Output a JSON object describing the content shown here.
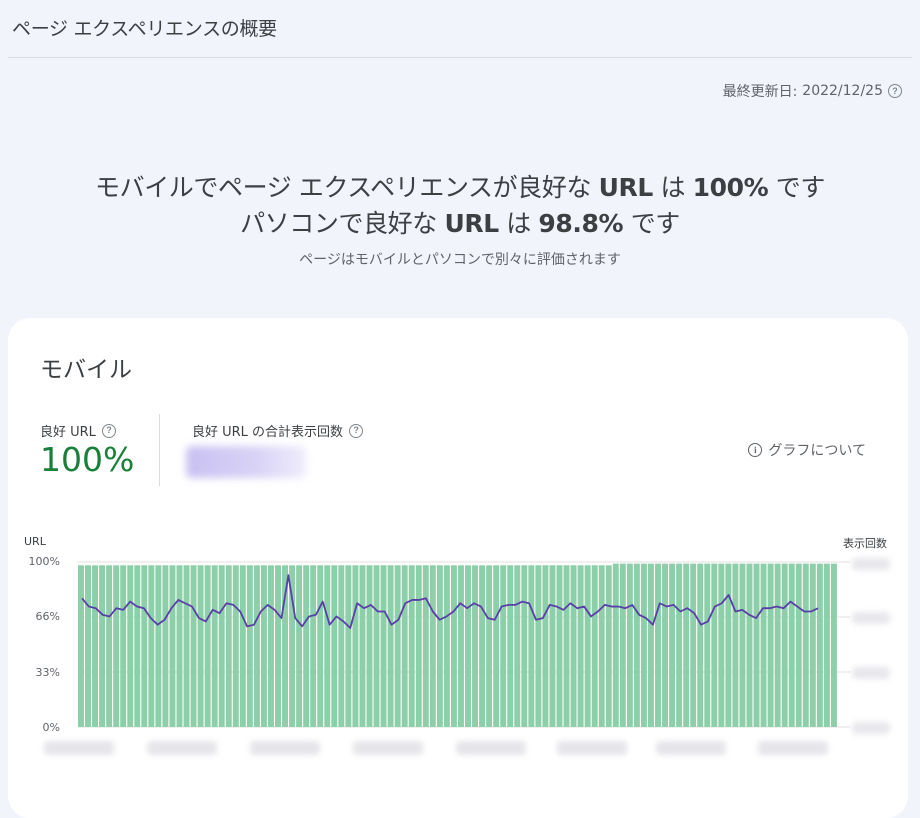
{
  "header": {
    "title": "ページ エクスペリエンスの概要",
    "last_updated_label": "最終更新日:",
    "last_updated_value": "2022/12/25"
  },
  "summary": {
    "mobile_prefix": "モバイルでページ エクスペリエンスが良好な",
    "mobile_url": "URL",
    "mobile_mid": "は",
    "mobile_pct": "100%",
    "mobile_suffix": "です",
    "desktop_prefix": "パソコンで良好な",
    "desktop_url": "URL",
    "desktop_mid": "は",
    "desktop_pct": "98.8%",
    "desktop_suffix": "です",
    "subtitle": "ページはモバイルとパソコンで別々に評価されます"
  },
  "card": {
    "title": "モバイル",
    "metric1_label": "良好 URL",
    "metric1_value": "100%",
    "metric2_label": "良好 URL の合計表示回数",
    "about_graph": "グラフについて"
  },
  "colors": {
    "bar": "#8ccfa9",
    "line": "#5b3fa8",
    "good": "#188038"
  },
  "chart_data": {
    "type": "bar",
    "left_axis_label": "URL",
    "right_axis_label": "表示回数",
    "y_ticks": [
      "100%",
      "66%",
      "33%",
      "0%"
    ],
    "ylim": [
      0,
      100
    ],
    "bars_pct": [
      98,
      98,
      98,
      98,
      98,
      98,
      98,
      98,
      98,
      98,
      98,
      98,
      98,
      98,
      98,
      98,
      98,
      98,
      98,
      98,
      98,
      98,
      98,
      98,
      98,
      98,
      98,
      98,
      98,
      98,
      98,
      98,
      98,
      98,
      98,
      98,
      98,
      98,
      98,
      98,
      98,
      98,
      98,
      98,
      98,
      98,
      98,
      98,
      98,
      98,
      98,
      98,
      98,
      98,
      98,
      98,
      98,
      98,
      98,
      98,
      98,
      98,
      98,
      98,
      98,
      98,
      98,
      98,
      98,
      98,
      98,
      98,
      98,
      98,
      98,
      98,
      99,
      99,
      99,
      99,
      99,
      99,
      99,
      99,
      99,
      99,
      99,
      99,
      99,
      99,
      99,
      99,
      99,
      99,
      99,
      99,
      99,
      99,
      99,
      99,
      99,
      99,
      99,
      99,
      99,
      99,
      99,
      99
    ],
    "impressions_pct": [
      78,
      73,
      72,
      68,
      67,
      72,
      71,
      76,
      73,
      72,
      66,
      62,
      65,
      72,
      77,
      75,
      73,
      66,
      64,
      71,
      69,
      75,
      74,
      70,
      61,
      62,
      70,
      74,
      71,
      66,
      92,
      66,
      61,
      67,
      68,
      76,
      62,
      67,
      64,
      60,
      75,
      72,
      74,
      70,
      70,
      62,
      65,
      75,
      77,
      77,
      78,
      70,
      65,
      67,
      70,
      75,
      72,
      75,
      73,
      66,
      65,
      73,
      74,
      74,
      76,
      75,
      65,
      66,
      74,
      73,
      71,
      75,
      72,
      73,
      67,
      70,
      74,
      73,
      73,
      72,
      74,
      68,
      66,
      62,
      75,
      73,
      74,
      70,
      72,
      69,
      62,
      64,
      73,
      75,
      80,
      70,
      71,
      68,
      66,
      72,
      72,
      73,
      72,
      76,
      73,
      70,
      70,
      72
    ]
  }
}
